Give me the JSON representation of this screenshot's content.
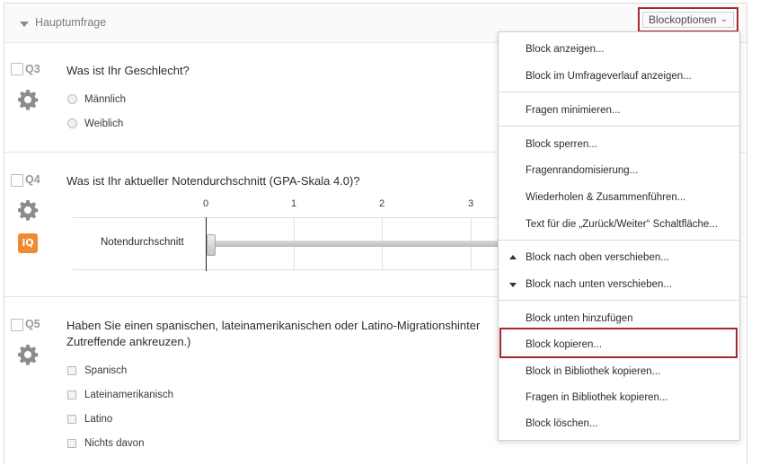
{
  "block": {
    "title": "Hauptumfrage",
    "options_label": "Blockoptionen"
  },
  "questions": [
    {
      "id": "Q3",
      "text": "Was ist Ihr Geschlecht?",
      "options": [
        "Männlich",
        "Weiblich"
      ]
    },
    {
      "id": "Q4",
      "text": "Was ist Ihr aktueller Notendurchschnitt (GPA-Skala 4.0)?",
      "ticks": [
        "0",
        "1",
        "2",
        "3"
      ],
      "slider_label": "Notendurchschnitt",
      "slider_value": 0
    },
    {
      "id": "Q5",
      "text_line1": "Haben Sie einen spanischen, lateinamerikanischen oder Latino-Migrationshinter",
      "text_line2": "Zutreffende ankreuzen.)",
      "options": [
        "Spanisch",
        "Lateinamerikanisch",
        "Latino",
        "Nichts davon"
      ]
    }
  ],
  "icons": {
    "gear": "gear-icon",
    "iq": "iQ"
  },
  "menu": {
    "items": [
      "Block anzeigen...",
      "Block im Umfrageverlauf anzeigen...",
      "Fragen minimieren...",
      "Block sperren...",
      "Fragenrandomisierung...",
      "Wiederholen & Zusammenführen...",
      "Text für die „Zurück/Weiter“ Schaltfläche...",
      "Block nach oben verschieben...",
      "Block nach unten verschieben...",
      "Block unten hinzufügen",
      "Block kopieren...",
      "Block in Bibliothek kopieren...",
      "Fragen in Bibliothek kopieren...",
      "Block löschen..."
    ]
  },
  "colors": {
    "highlight": "#a5282f",
    "iq_orange": "#ef8a32"
  }
}
